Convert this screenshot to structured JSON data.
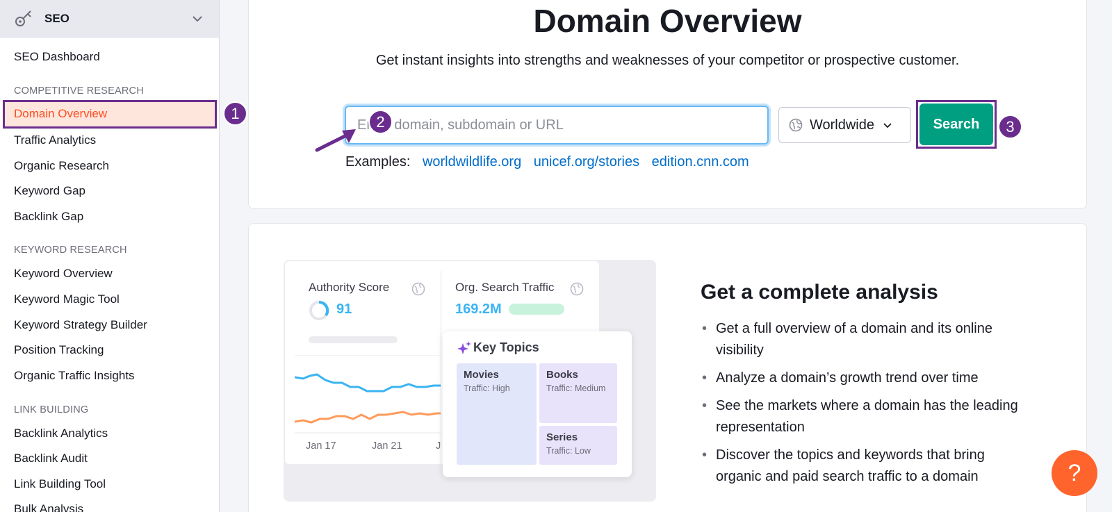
{
  "sidebar": {
    "tool_title": "SEO",
    "dashboard": "SEO Dashboard",
    "sections": {
      "competitive": "COMPETITIVE RESEARCH",
      "keyword": "KEYWORD RESEARCH",
      "link": "LINK BUILDING"
    },
    "competitive_items": [
      "Domain Overview",
      "Traffic Analytics",
      "Organic Research",
      "Keyword Gap",
      "Backlink Gap"
    ],
    "keyword_items": [
      "Keyword Overview",
      "Keyword Magic Tool",
      "Keyword Strategy Builder",
      "Position Tracking",
      "Organic Traffic Insights"
    ],
    "link_items": [
      "Backlink Analytics",
      "Backlink Audit",
      "Link Building Tool",
      "Bulk Analysis"
    ],
    "active_item": "Domain Overview"
  },
  "annotations": [
    "1",
    "2",
    "3"
  ],
  "main": {
    "title": "Domain Overview",
    "subtitle": "Get instant insights into strengths and weaknesses of your competitor or prospective customer.",
    "search_placeholder": "Enter domain, subdomain or URL",
    "database": "Worldwide",
    "search_button": "Search",
    "examples_label": "Examples:",
    "examples": [
      "worldwildlife.org",
      "unicef.org/stories",
      "edition.cnn.com"
    ]
  },
  "illustration": {
    "authority_label": "Authority Score",
    "authority_value": "91",
    "traffic_label": "Org. Search Traffic",
    "traffic_value": "169.2M",
    "dates": [
      "Jan 17",
      "Jan 21",
      "J"
    ],
    "key_topics_title": "Key Topics",
    "topics": [
      {
        "name": "Movies",
        "traffic": "Traffic: High"
      },
      {
        "name": "Books",
        "traffic": "Traffic: Medium"
      },
      {
        "name": "Series",
        "traffic": "Traffic: Low"
      }
    ]
  },
  "analysis": {
    "title": "Get a complete analysis",
    "bullets": [
      "Get a full overview of a domain and its online visibility",
      "Analyze a domain’s growth trend over time",
      "See the markets where a domain has the leading representation",
      "Discover the topics and keywords that bring organic and paid search traffic to a domain"
    ]
  },
  "help_label": "?",
  "colors": {
    "accent_purple": "#6a2d8e",
    "active_orange": "#ff4c1f",
    "search_green": "#009f81",
    "link_blue": "#006dca",
    "help_orange": "#ff642d"
  }
}
